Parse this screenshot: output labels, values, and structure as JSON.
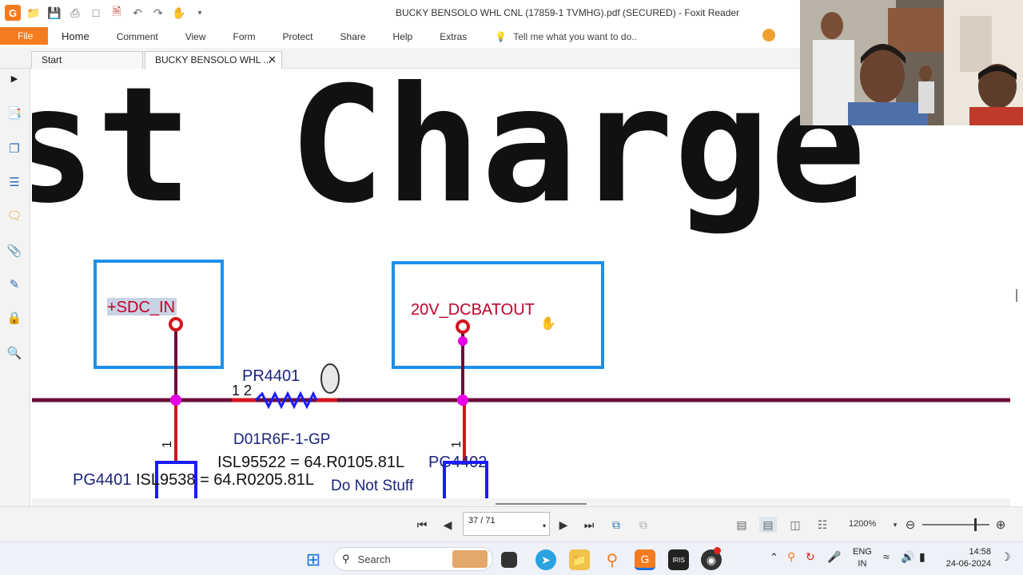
{
  "window": {
    "title": "BUCKY BENSOLO WHL CNL (17859-1 TVMHG).pdf (SECURED) - Foxit Reader"
  },
  "ribbon": {
    "tabs": [
      "File",
      "Home",
      "Comment",
      "View",
      "Form",
      "Protect",
      "Share",
      "Help",
      "Extras"
    ],
    "tell_me": "Tell me what you want to do.."
  },
  "doc_tabs": {
    "start": "Start",
    "active": "BUCKY BENSOLO WHL ..."
  },
  "schematic": {
    "heading": "st Charge",
    "net_left": "+SDC_IN",
    "net_right": "20V_DCBATOUT",
    "resistor_ref": "PR4401",
    "resistor_pins": "1 2",
    "resistor_part": "D01R6F-1-GP",
    "pin_left": "1",
    "pin_right": "1",
    "note_isl95522": "ISL95522 = 64.R0105.81L",
    "pg4402": "PG4402",
    "pg4401": "PG4401",
    "note_isl9538": "ISL9538 = 64.R0205.81L",
    "do_not_stuff": "Do Not Stuff",
    "colors": {
      "wire": "#6b0f3a",
      "net_box": "#1e8fe8",
      "net_text": "#c0002a",
      "junction": "#e600e6",
      "resistor": "#1a1aff",
      "label": "#1a237e"
    }
  },
  "navigation": {
    "page": "37 / 71",
    "zoom": "1200%"
  },
  "taskbar": {
    "search": "Search",
    "lang": "ENG",
    "region": "IN",
    "time": "14:58",
    "date": "24-06-2024"
  }
}
